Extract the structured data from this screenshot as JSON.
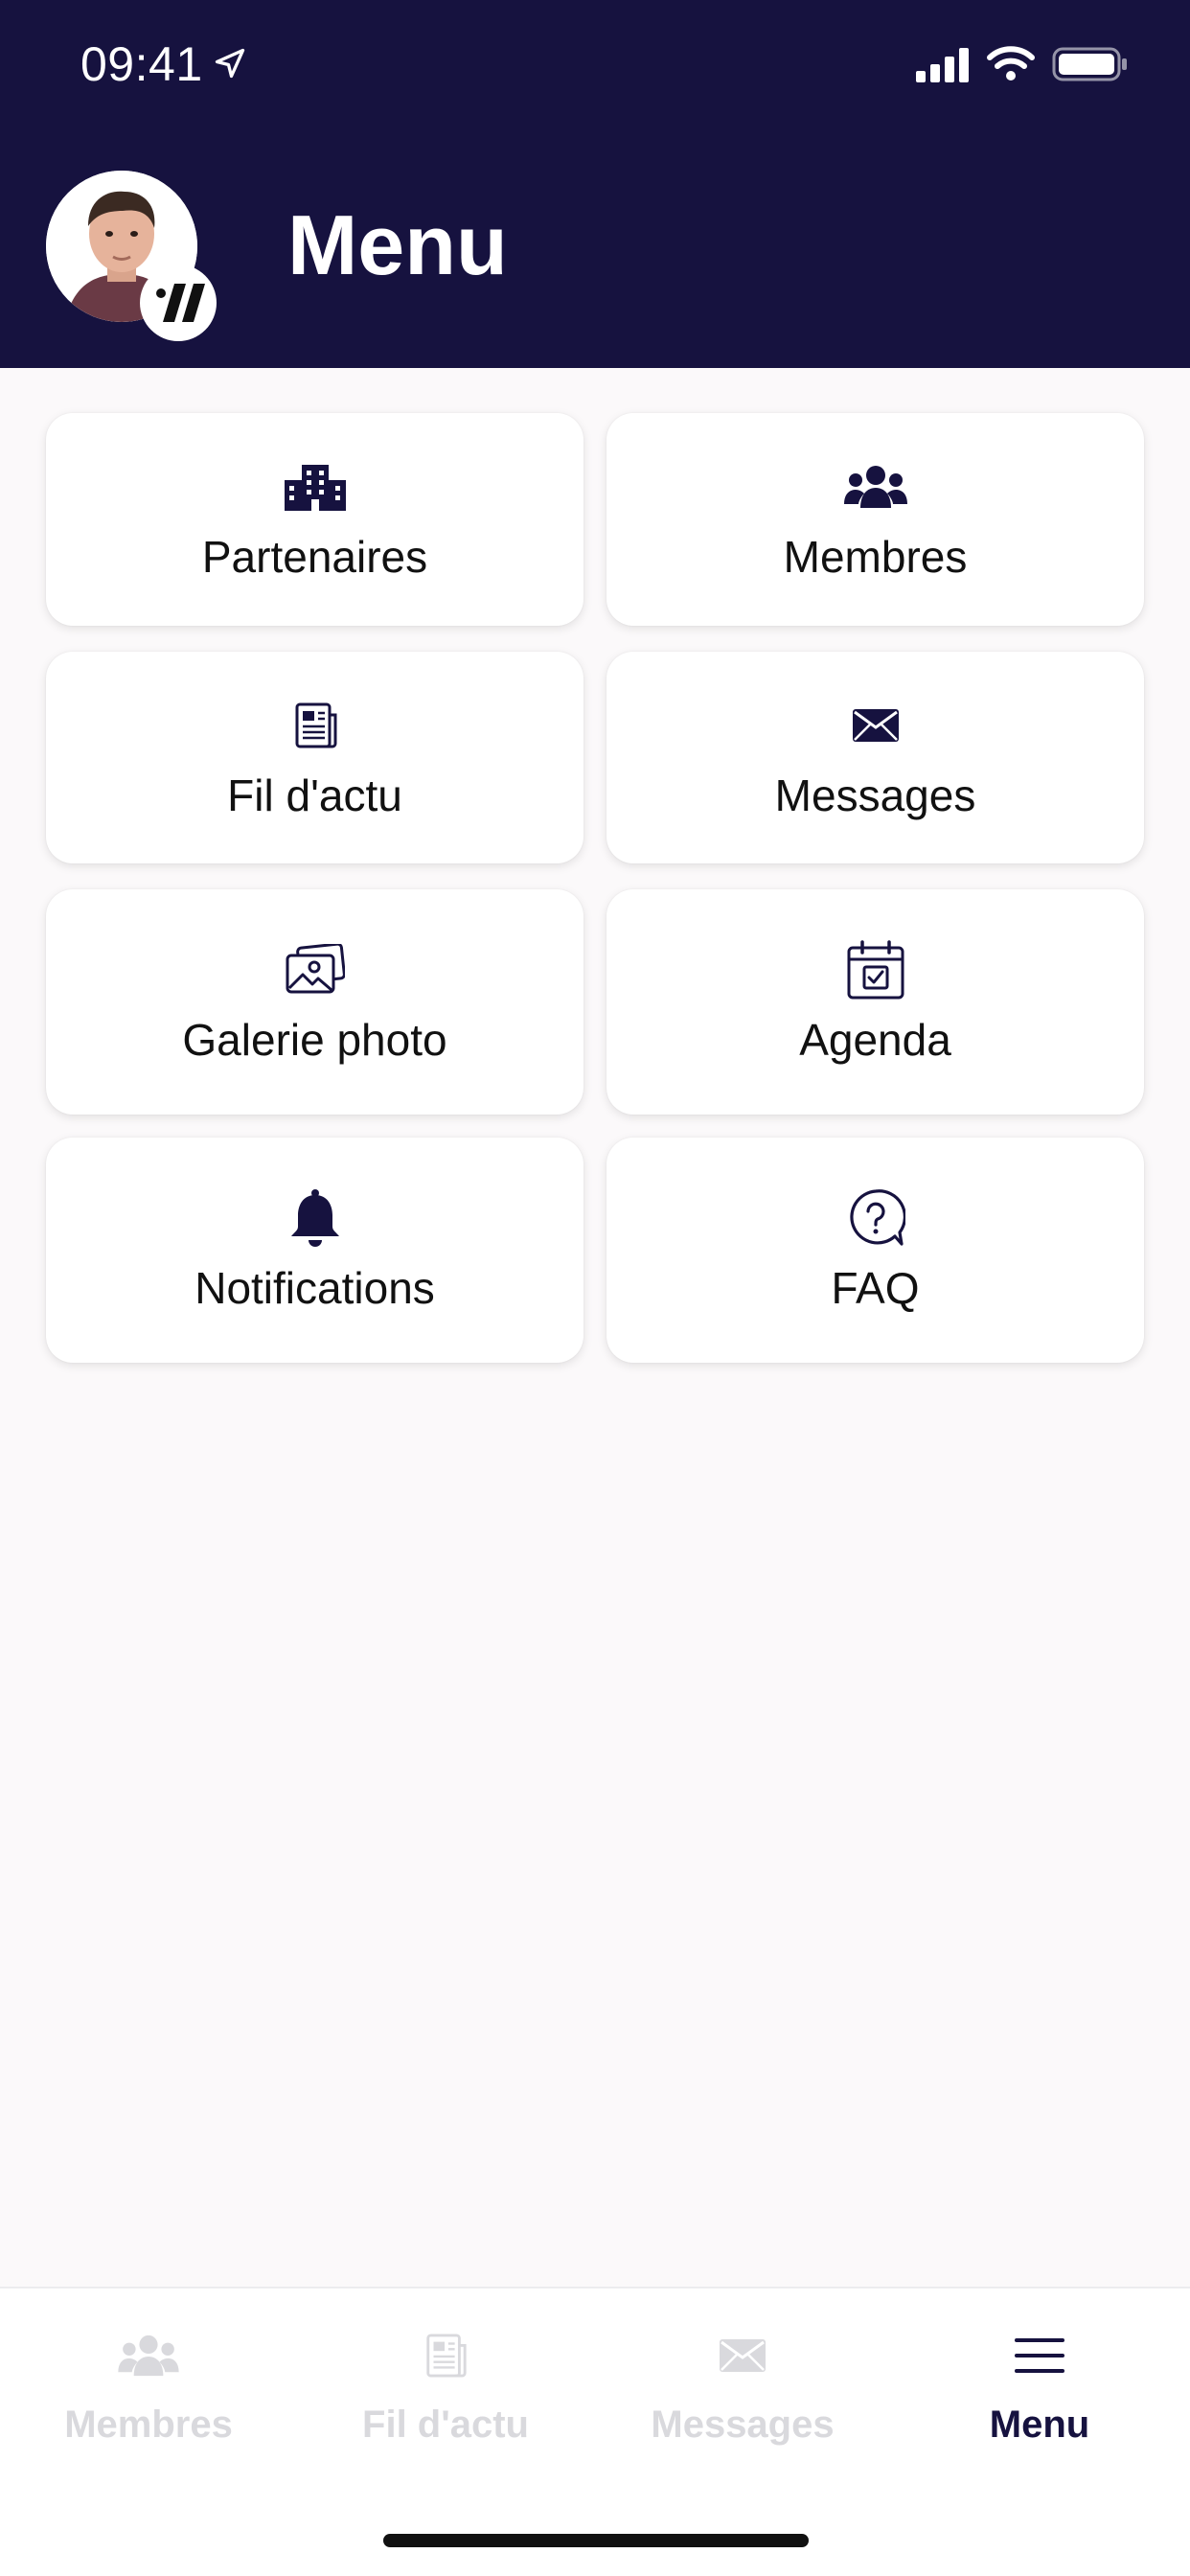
{
  "status_bar": {
    "time": "09:41"
  },
  "header": {
    "title": "Menu"
  },
  "menu_items": [
    {
      "label": "Partenaires",
      "icon": "building-icon"
    },
    {
      "label": "Membres",
      "icon": "users-icon"
    },
    {
      "label": "Fil d'actu",
      "icon": "newspaper-icon"
    },
    {
      "label": "Messages",
      "icon": "envelope-icon"
    },
    {
      "label": "Galerie photo",
      "icon": "photo-gallery-icon"
    },
    {
      "label": "Agenda",
      "icon": "calendar-check-icon"
    },
    {
      "label": "Notifications",
      "icon": "bell-icon"
    },
    {
      "label": "FAQ",
      "icon": "question-bubble-icon"
    }
  ],
  "tabbar": {
    "items": [
      {
        "label": "Membres",
        "icon": "users-icon",
        "active": false
      },
      {
        "label": "Fil d'actu",
        "icon": "newspaper-icon",
        "active": false
      },
      {
        "label": "Messages",
        "icon": "envelope-icon",
        "active": false
      },
      {
        "label": "Menu",
        "icon": "hamburger-icon",
        "active": true
      }
    ]
  },
  "colors": {
    "header_bg": "#16123f",
    "icon_dark": "#16123f",
    "tab_inactive": "#d9d9dd",
    "background": "#fbf9fa"
  }
}
